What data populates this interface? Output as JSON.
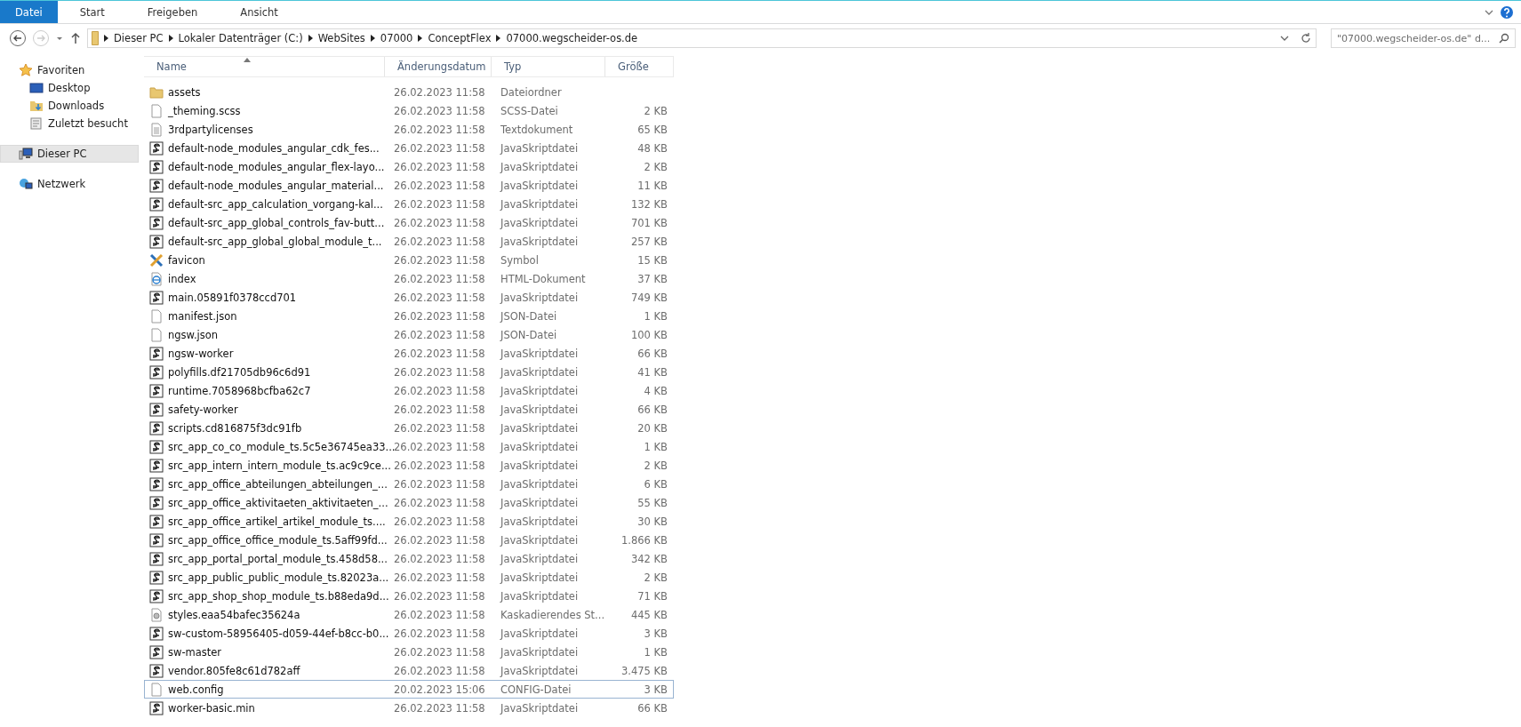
{
  "ribbon": {
    "tabs": [
      {
        "label": "Datei",
        "kind": "file"
      },
      {
        "label": "Start",
        "kind": "plain"
      },
      {
        "label": "Freigeben",
        "kind": "plain"
      },
      {
        "label": "Ansicht",
        "kind": "plain"
      }
    ]
  },
  "address_bar": {
    "path": [
      "Dieser PC",
      "Lokaler Datenträger (C:)",
      "WebSites",
      "07000",
      "ConceptFlex",
      "07000.wegscheider-os.de"
    ]
  },
  "search": {
    "placeholder": "\"07000.wegscheider-os.de\" d..."
  },
  "sidebar": {
    "groups": [
      {
        "label": "Favoriten",
        "kind": "star",
        "selected": false,
        "children": [
          {
            "label": "Desktop",
            "kind": "desktop",
            "selected": false
          },
          {
            "label": "Downloads",
            "kind": "downloads",
            "selected": false
          },
          {
            "label": "Zuletzt besucht",
            "kind": "recent",
            "selected": false
          }
        ]
      },
      {
        "label": "Dieser PC",
        "kind": "pc",
        "selected": true
      },
      {
        "label": "Netzwerk",
        "kind": "network",
        "selected": false
      }
    ]
  },
  "table": {
    "columns": [
      "Name",
      "Änderungsdatum",
      "Typ",
      "Größe"
    ],
    "rows": [
      {
        "name": "assets",
        "date": "26.02.2023 11:58",
        "type": "Dateiordner",
        "kind": "folder",
        "focused": false
      },
      {
        "name": "_theming.scss",
        "date": "26.02.2023 11:58",
        "type": "SCSS-Datei",
        "size": "2 KB",
        "kind": "file",
        "focused": false
      },
      {
        "name": "3rdpartylicenses",
        "date": "26.02.2023 11:58",
        "type": "Textdokument",
        "size": "65 KB",
        "kind": "text",
        "focused": false
      },
      {
        "name": "default-node_modules_angular_cdk_fes...",
        "date": "26.02.2023 11:58",
        "type": "JavaSkriptdatei",
        "size": "48 KB",
        "kind": "script",
        "focused": false
      },
      {
        "name": "default-node_modules_angular_flex-layo...",
        "date": "26.02.2023 11:58",
        "type": "JavaSkriptdatei",
        "size": "2 KB",
        "kind": "script",
        "focused": false
      },
      {
        "name": "default-node_modules_angular_material...",
        "date": "26.02.2023 11:58",
        "type": "JavaSkriptdatei",
        "size": "11 KB",
        "kind": "script",
        "focused": false
      },
      {
        "name": "default-src_app_calculation_vorgang-kal...",
        "date": "26.02.2023 11:58",
        "type": "JavaSkriptdatei",
        "size": "132 KB",
        "kind": "script",
        "focused": false
      },
      {
        "name": "default-src_app_global_controls_fav-butt...",
        "date": "26.02.2023 11:58",
        "type": "JavaSkriptdatei",
        "size": "701 KB",
        "kind": "script",
        "focused": false
      },
      {
        "name": "default-src_app_global_global_module_t...",
        "date": "26.02.2023 11:58",
        "type": "JavaSkriptdatei",
        "size": "257 KB",
        "kind": "script",
        "focused": false
      },
      {
        "name": "favicon",
        "date": "26.02.2023 11:58",
        "type": "Symbol",
        "size": "15 KB",
        "kind": "favicon",
        "focused": false
      },
      {
        "name": "index",
        "date": "26.02.2023 11:58",
        "type": "HTML-Dokument",
        "size": "37 KB",
        "kind": "html",
        "focused": false
      },
      {
        "name": "main.05891f0378ccd701",
        "date": "26.02.2023 11:58",
        "type": "JavaSkriptdatei",
        "size": "749 KB",
        "kind": "script",
        "focused": false
      },
      {
        "name": "manifest.json",
        "date": "26.02.2023 11:58",
        "type": "JSON-Datei",
        "size": "1 KB",
        "kind": "file",
        "focused": false
      },
      {
        "name": "ngsw.json",
        "date": "26.02.2023 11:58",
        "type": "JSON-Datei",
        "size": "100 KB",
        "kind": "file",
        "focused": false
      },
      {
        "name": "ngsw-worker",
        "date": "26.02.2023 11:58",
        "type": "JavaSkriptdatei",
        "size": "66 KB",
        "kind": "script",
        "focused": false
      },
      {
        "name": "polyfills.df21705db96c6d91",
        "date": "26.02.2023 11:58",
        "type": "JavaSkriptdatei",
        "size": "41 KB",
        "kind": "script",
        "focused": false
      },
      {
        "name": "runtime.7058968bcfba62c7",
        "date": "26.02.2023 11:58",
        "type": "JavaSkriptdatei",
        "size": "4 KB",
        "kind": "script",
        "focused": false
      },
      {
        "name": "safety-worker",
        "date": "26.02.2023 11:58",
        "type": "JavaSkriptdatei",
        "size": "66 KB",
        "kind": "script",
        "focused": false
      },
      {
        "name": "scripts.cd816875f3dc91fb",
        "date": "26.02.2023 11:58",
        "type": "JavaSkriptdatei",
        "size": "20 KB",
        "kind": "script",
        "focused": false
      },
      {
        "name": "src_app_co_co_module_ts.5c5e36745ea33...",
        "date": "26.02.2023 11:58",
        "type": "JavaSkriptdatei",
        "size": "1 KB",
        "kind": "script",
        "focused": false
      },
      {
        "name": "src_app_intern_intern_module_ts.ac9c9ce...",
        "date": "26.02.2023 11:58",
        "type": "JavaSkriptdatei",
        "size": "2 KB",
        "kind": "script",
        "focused": false
      },
      {
        "name": "src_app_office_abteilungen_abteilungen_...",
        "date": "26.02.2023 11:58",
        "type": "JavaSkriptdatei",
        "size": "6 KB",
        "kind": "script",
        "focused": false
      },
      {
        "name": "src_app_office_aktivitaeten_aktivitaeten_...",
        "date": "26.02.2023 11:58",
        "type": "JavaSkriptdatei",
        "size": "55 KB",
        "kind": "script",
        "focused": false
      },
      {
        "name": "src_app_office_artikel_artikel_module_ts....",
        "date": "26.02.2023 11:58",
        "type": "JavaSkriptdatei",
        "size": "30 KB",
        "kind": "script",
        "focused": false
      },
      {
        "name": "src_app_office_office_module_ts.5aff99fd...",
        "date": "26.02.2023 11:58",
        "type": "JavaSkriptdatei",
        "size": "1.866 KB",
        "kind": "script",
        "focused": false
      },
      {
        "name": "src_app_portal_portal_module_ts.458d58...",
        "date": "26.02.2023 11:58",
        "type": "JavaSkriptdatei",
        "size": "342 KB",
        "kind": "script",
        "focused": false
      },
      {
        "name": "src_app_public_public_module_ts.82023a...",
        "date": "26.02.2023 11:58",
        "type": "JavaSkriptdatei",
        "size": "2 KB",
        "kind": "script",
        "focused": false
      },
      {
        "name": "src_app_shop_shop_module_ts.b88eda9d...",
        "date": "26.02.2023 11:58",
        "type": "JavaSkriptdatei",
        "size": "71 KB",
        "kind": "script",
        "focused": false
      },
      {
        "name": "styles.eaa54bafec35624a",
        "date": "26.02.2023 11:58",
        "type": "Kaskadierendes St...",
        "size": "445 KB",
        "kind": "css",
        "focused": false
      },
      {
        "name": "sw-custom-58956405-d059-44ef-b8cc-b0...",
        "date": "26.02.2023 11:58",
        "type": "JavaSkriptdatei",
        "size": "3 KB",
        "kind": "script",
        "focused": false
      },
      {
        "name": "sw-master",
        "date": "26.02.2023 11:58",
        "type": "JavaSkriptdatei",
        "size": "1 KB",
        "kind": "script",
        "focused": false
      },
      {
        "name": "vendor.805fe8c61d782aff",
        "date": "26.02.2023 11:58",
        "type": "JavaSkriptdatei",
        "size": "3.475 KB",
        "kind": "script",
        "focused": false
      },
      {
        "name": "web.config",
        "date": "20.02.2023 15:06",
        "type": "CONFIG-Datei",
        "size": "3 KB",
        "kind": "file",
        "focused": true
      },
      {
        "name": "worker-basic.min",
        "date": "26.02.2023 11:58",
        "type": "JavaSkriptdatei",
        "size": "66 KB",
        "kind": "script",
        "focused": false
      }
    ]
  }
}
